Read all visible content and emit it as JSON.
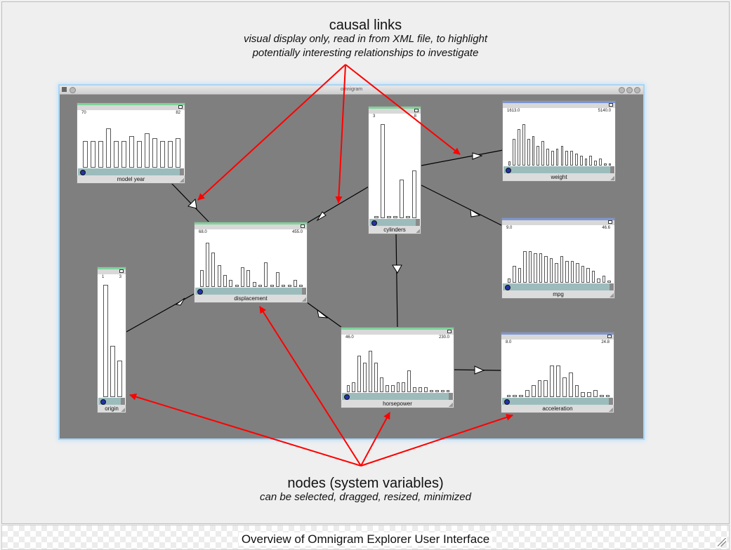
{
  "annotations": {
    "causal_title": "causal links",
    "causal_sub1": "visual display only, read in from XML file, to highlight",
    "causal_sub2": "potentially interesting relationships to investigate",
    "nodes_title": "nodes (system variables)",
    "nodes_sub": "can be selected, dragged, resized, minimized"
  },
  "caption": "Overview of Omnigram Explorer User Interface",
  "window": {
    "title": "omnigram"
  },
  "colors": {
    "arrow": "#ff0000",
    "node_green": "#7fd39a",
    "node_blue": "#7c96d4",
    "canvas": "#7f7f7f"
  },
  "nodes": [
    {
      "name": "model year",
      "lo": "70",
      "hi": "82",
      "bar_color": "green",
      "hist": [
        0.55,
        0.55,
        0.55,
        0.8,
        0.55,
        0.55,
        0.65,
        0.55,
        0.7,
        0.6,
        0.55,
        0.55,
        0.6
      ]
    },
    {
      "name": "displacement",
      "lo": "68.0",
      "hi": "455.0",
      "bar_color": "green",
      "hist": [
        0.35,
        0.9,
        0.7,
        0.45,
        0.25,
        0.15,
        0.05,
        0.4,
        0.35,
        0.1,
        0.05,
        0.5,
        0.05,
        0.3,
        0.05,
        0.05,
        0.15,
        0.05
      ]
    },
    {
      "name": "cylinders",
      "lo": "3",
      "hi": "8",
      "bar_color": "green",
      "hist": [
        0.02,
        0.98,
        0.02,
        0.02,
        0.4,
        0.0,
        0.5
      ]
    },
    {
      "name": "weight",
      "lo": "1613.0",
      "hi": "5140.0",
      "bar_color": "blue",
      "hist": [
        0.08,
        0.55,
        0.75,
        0.85,
        0.55,
        0.6,
        0.4,
        0.5,
        0.35,
        0.3,
        0.35,
        0.4,
        0.3,
        0.3,
        0.25,
        0.2,
        0.15,
        0.2,
        0.1,
        0.15,
        0.05,
        0.05
      ]
    },
    {
      "name": "mpg",
      "lo": "9.0",
      "hi": "46.6",
      "bar_color": "blue",
      "hist": [
        0.08,
        0.35,
        0.3,
        0.65,
        0.65,
        0.6,
        0.6,
        0.55,
        0.5,
        0.4,
        0.55,
        0.45,
        0.45,
        0.4,
        0.35,
        0.3,
        0.25,
        0.08,
        0.15,
        0.05
      ]
    },
    {
      "name": "origin",
      "lo": "1",
      "hi": "3",
      "bar_color": "green",
      "hist": [
        0.98,
        0.45,
        0.32
      ]
    },
    {
      "name": "horsepower",
      "lo": "46.0",
      "hi": "230.0",
      "bar_color": "green",
      "hist": [
        0.15,
        0.2,
        0.75,
        0.6,
        0.85,
        0.6,
        0.3,
        0.15,
        0.15,
        0.2,
        0.2,
        0.45,
        0.1,
        0.1,
        0.1,
        0.05,
        0.05,
        0.05,
        0.05
      ]
    },
    {
      "name": "acceleration",
      "lo": "8.0",
      "hi": "24.8",
      "bar_color": "blue",
      "hist": [
        0.05,
        0.05,
        0.05,
        0.15,
        0.25,
        0.35,
        0.35,
        0.65,
        0.65,
        0.4,
        0.5,
        0.25,
        0.1,
        0.1,
        0.15,
        0.05,
        0.05
      ]
    }
  ]
}
